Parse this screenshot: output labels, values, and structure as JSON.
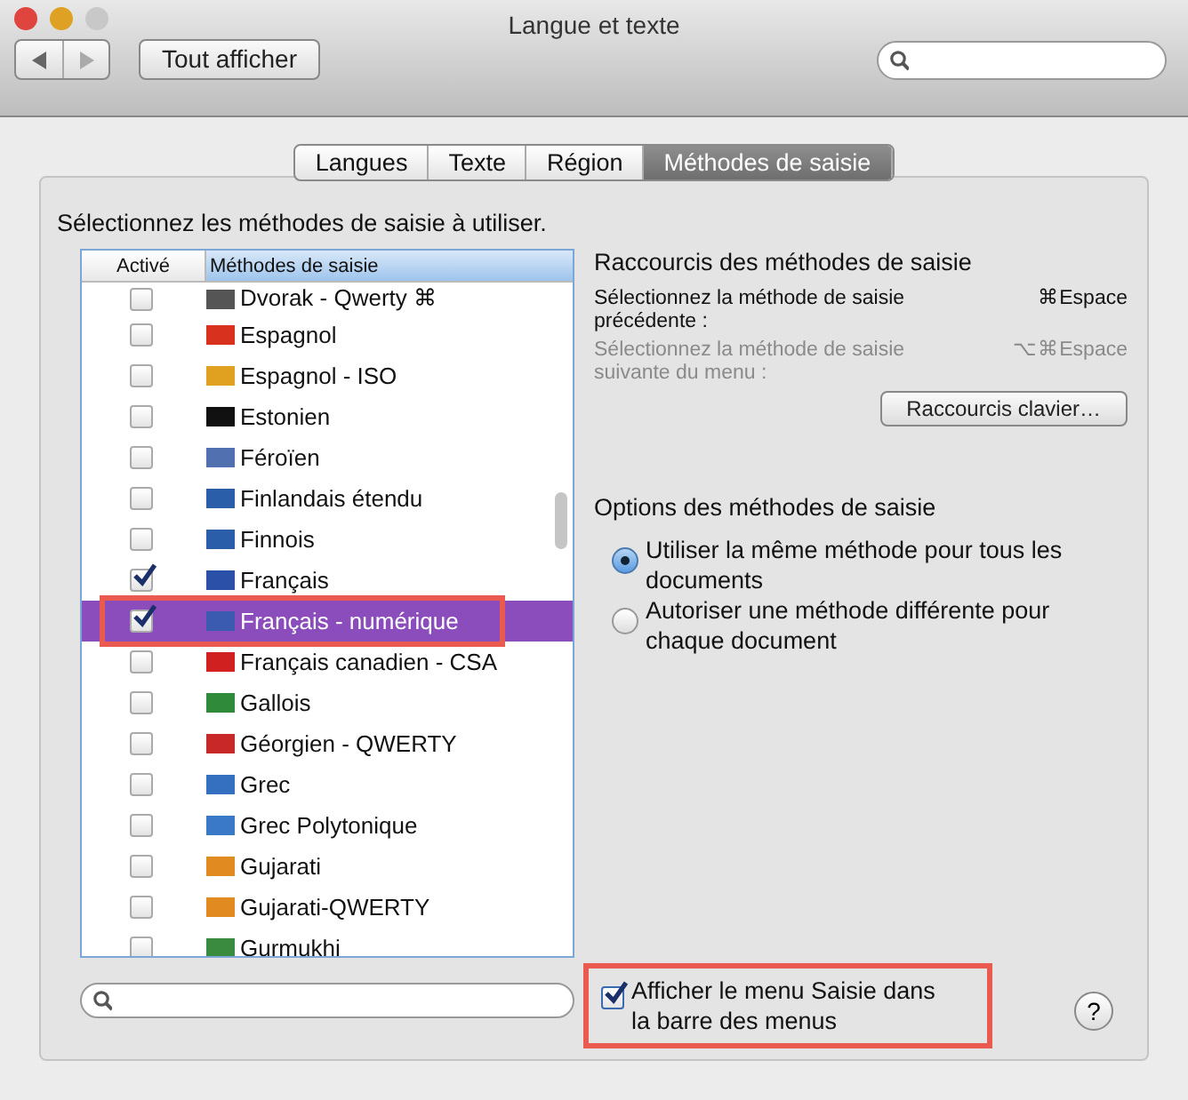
{
  "window": {
    "title": "Langue et texte"
  },
  "toolbar": {
    "show_all_button": "Tout afficher"
  },
  "tabs": [
    {
      "label": "Langues",
      "selected": false
    },
    {
      "label": "Texte",
      "selected": false
    },
    {
      "label": "Région",
      "selected": false
    },
    {
      "label": "Méthodes de saisie",
      "selected": true
    }
  ],
  "instruction": "Sélectionnez les méthodes de saisie à utiliser.",
  "table": {
    "columns": [
      "Activé",
      "Méthodes de saisie"
    ],
    "rows": [
      {
        "name": "Dvorak - Qwerty ⌘",
        "checked": false,
        "selected": false,
        "highlighted": false,
        "color": "#555555"
      },
      {
        "name": "Espagnol",
        "checked": false,
        "selected": false,
        "highlighted": false,
        "color": "#d8321e"
      },
      {
        "name": "Espagnol - ISO",
        "checked": false,
        "selected": false,
        "highlighted": false,
        "color": "#e0a020"
      },
      {
        "name": "Estonien",
        "checked": false,
        "selected": false,
        "highlighted": false,
        "color": "#111111"
      },
      {
        "name": "Féroïen",
        "checked": false,
        "selected": false,
        "highlighted": false,
        "color": "#5070b0"
      },
      {
        "name": "Finlandais étendu",
        "checked": false,
        "selected": false,
        "highlighted": false,
        "color": "#2a5ea8"
      },
      {
        "name": "Finnois",
        "checked": false,
        "selected": false,
        "highlighted": false,
        "color": "#2a5ea8"
      },
      {
        "name": "Français",
        "checked": true,
        "selected": false,
        "highlighted": false,
        "color": "#2b50a8"
      },
      {
        "name": "Français - numérique",
        "checked": true,
        "selected": true,
        "highlighted": true,
        "color": "#3a5bb0"
      },
      {
        "name": "Français canadien - CSA",
        "checked": false,
        "selected": false,
        "highlighted": false,
        "color": "#d02020"
      },
      {
        "name": "Gallois",
        "checked": false,
        "selected": false,
        "highlighted": false,
        "color": "#2f8a3a"
      },
      {
        "name": "Géorgien - QWERTY",
        "checked": false,
        "selected": false,
        "highlighted": false,
        "color": "#c82828"
      },
      {
        "name": "Grec",
        "checked": false,
        "selected": false,
        "highlighted": false,
        "color": "#3570c0"
      },
      {
        "name": "Grec Polytonique",
        "checked": false,
        "selected": false,
        "highlighted": false,
        "color": "#3a78c8"
      },
      {
        "name": "Gujarati",
        "checked": false,
        "selected": false,
        "highlighted": false,
        "color": "#e08a20"
      },
      {
        "name": "Gujarati-QWERTY",
        "checked": false,
        "selected": false,
        "highlighted": false,
        "color": "#e08a20"
      },
      {
        "name": "Gurmukhi",
        "checked": false,
        "selected": false,
        "highlighted": false,
        "color": "#3a8a40"
      }
    ]
  },
  "shortcuts": {
    "title": "Raccourcis des méthodes de saisie",
    "items": [
      {
        "label": "Sélectionnez la méthode de saisie précédente :",
        "keys": "⌘Espace",
        "disabled": false
      },
      {
        "label": "Sélectionnez la méthode de saisie suivante du menu :",
        "keys": "⌥⌘Espace",
        "disabled": true
      }
    ],
    "button": "Raccourcis clavier…"
  },
  "options": {
    "title": "Options des méthodes de saisie",
    "radios": [
      {
        "label": "Utiliser la même méthode pour tous les documents",
        "selected": true
      },
      {
        "label": "Autoriser une méthode différente pour chaque document",
        "selected": false
      }
    ]
  },
  "menu_checkbox": {
    "label": "Afficher le menu Saisie dans la barre des menus",
    "checked": true,
    "highlighted": true
  },
  "help_button": "?"
}
